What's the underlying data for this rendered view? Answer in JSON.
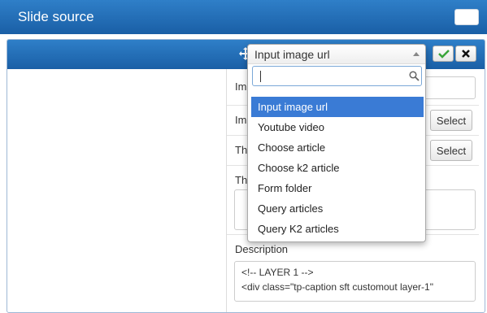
{
  "dialog": {
    "title": "Slide source"
  },
  "panel": {
    "ok_label": "✔",
    "cancel_label": "✖"
  },
  "form": {
    "rows": [
      {
        "label": "Image"
      },
      {
        "label": "Image",
        "button": "Select"
      },
      {
        "label": "Thumb",
        "button": "Select"
      },
      {
        "label": "Thumb"
      }
    ],
    "description": {
      "label": "Description",
      "lines": [
        "<!-- LAYER 1 -->",
        "<div class=\"tp-caption sft customout layer-1\""
      ]
    }
  },
  "dropdown": {
    "selected": "Input image url",
    "search_value": "",
    "options": [
      "Input image url",
      "Youtube video",
      "Choose article",
      "Choose k2 article",
      "Form folder",
      "Query articles",
      "Query K2 articles"
    ],
    "active_index": 0
  },
  "colors": {
    "header_blue": "#1f6ab4",
    "highlight_blue": "#3a7bd5",
    "ok_green": "#3aa53a"
  },
  "icons": {
    "move": "move-icon",
    "ok": "check-icon",
    "cancel": "close-icon",
    "search": "search-icon"
  }
}
